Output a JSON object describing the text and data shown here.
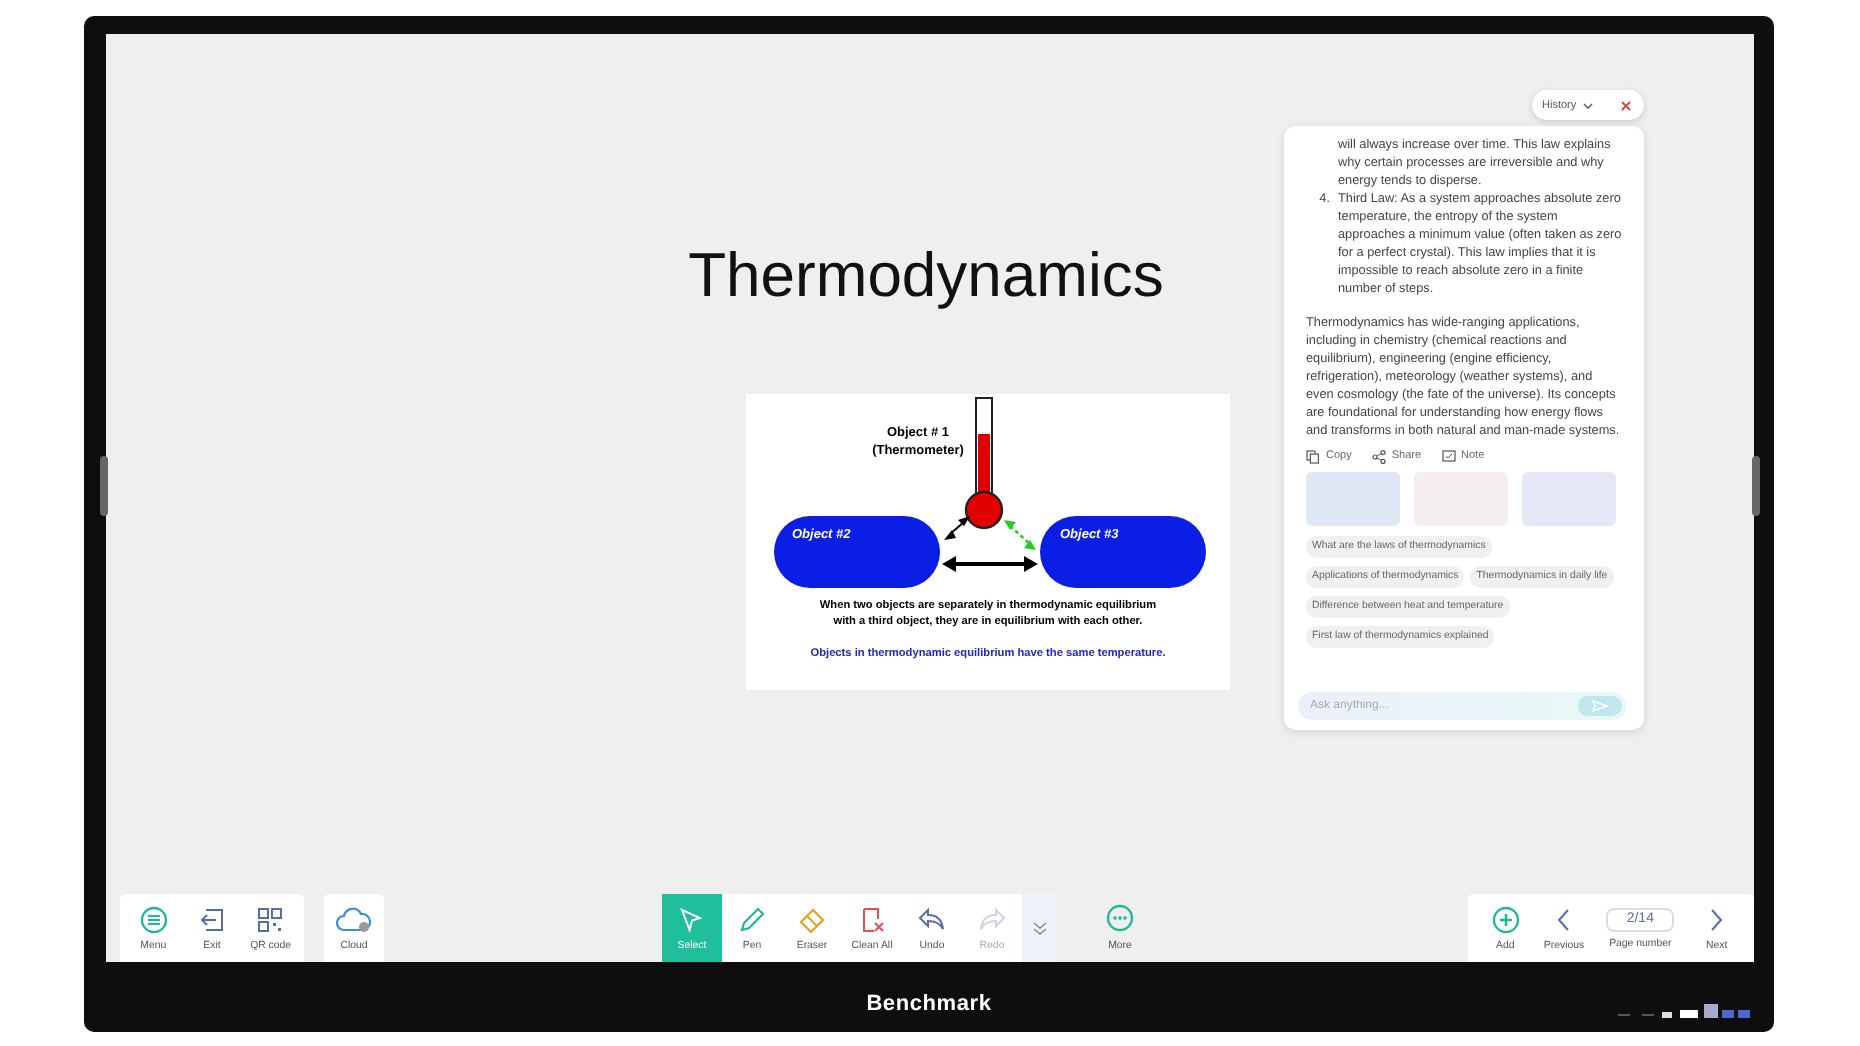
{
  "slide": {
    "title": "Thermodynamics",
    "diagram": {
      "object_1": "Object # 1",
      "object_1_note": "(Thermometer)",
      "object_2": "Object #2",
      "object_3": "Object #3",
      "caption_lines": [
        "When two objects are separately in thermodynamic equilibrium",
        "with a third object, they are in equilibrium with each other."
      ],
      "conclusion": "Objects in thermodynamic  equilibrium  have the same temperature."
    }
  },
  "assistant_panel": {
    "history_button": "History",
    "list_items": [
      {
        "marker": "",
        "text": "will always increase over time. This law explains why certain processes are irreversible and why energy tends to disperse."
      },
      {
        "marker": "4.",
        "text": "Third Law: As a system approaches absolute zero temperature, the entropy of the system approaches a minimum value (often taken as zero for a perfect crystal). This law implies that it is impossible to reach absolute zero in a finite number of steps."
      }
    ],
    "paragraph": "Thermodynamics has wide-ranging applications, including in chemistry (chemical reactions and equilibrium), engineering (engine efficiency, refrigeration), meteorology (weather systems), and even cosmology (the fate of the universe). Its concepts are foundational for understanding how energy flows and transforms in both natural and man-made systems.",
    "actions": [
      {
        "kind": "copy",
        "label": "Copy"
      },
      {
        "kind": "share",
        "label": "Share"
      },
      {
        "kind": "note",
        "label": "Note"
      }
    ],
    "suggestions": [
      "What are the laws of thermodynamics",
      "Applications of thermodynamics",
      "Thermodynamics in daily life",
      "Difference between heat and temperature",
      "First law of thermodynamics explained"
    ],
    "input": {
      "placeholder": "Ask anything..."
    }
  },
  "toolbar": {
    "left_groups": [
      [
        {
          "kind": "menu",
          "label": "Menu"
        },
        {
          "kind": "exit",
          "label": "Exit"
        },
        {
          "kind": "qr",
          "label": "QR code"
        }
      ],
      [
        {
          "kind": "cloud",
          "label": "Cloud"
        }
      ]
    ],
    "tools": [
      {
        "kind": "select",
        "label": "Select",
        "selected": true,
        "disabled": false
      },
      {
        "kind": "pen",
        "label": "Pen",
        "selected": false,
        "disabled": false
      },
      {
        "kind": "eraser",
        "label": "Eraser",
        "selected": false,
        "disabled": false
      },
      {
        "kind": "clear",
        "label": "Clean All",
        "selected": false,
        "disabled": false
      },
      {
        "kind": "undo",
        "label": "Undo",
        "selected": false,
        "disabled": false
      },
      {
        "kind": "redo",
        "label": "Redo",
        "selected": false,
        "disabled": true
      }
    ],
    "more": "More",
    "pager": {
      "add": "Add",
      "previous": "Previous",
      "page": "2/14",
      "page_label": "Page number",
      "next": "Next"
    }
  },
  "bezel": {
    "brand": "Benchmark"
  }
}
